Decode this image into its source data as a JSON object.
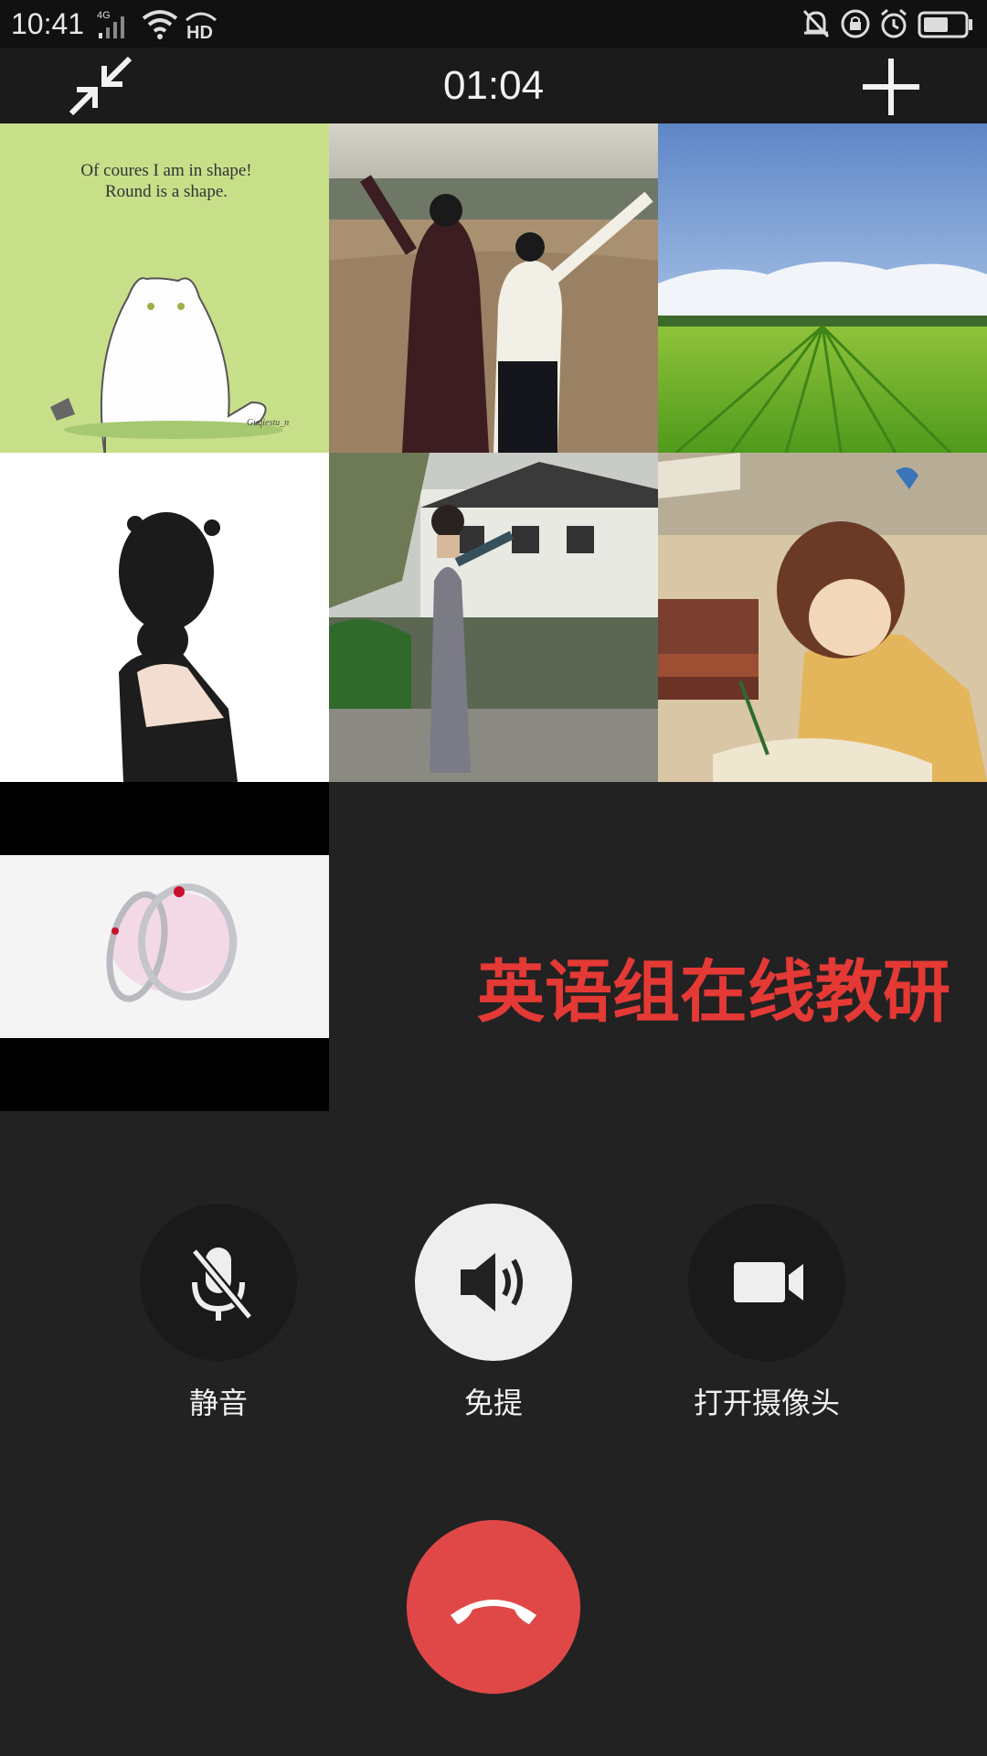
{
  "status_bar": {
    "time": "10:41",
    "network": "4G",
    "hd": "HD"
  },
  "header": {
    "timer": "01:04",
    "minimize_icon": "collapse-arrows-icon",
    "add_icon": "plus-icon"
  },
  "participants": [
    {
      "caption_line1": "Of coures I am in shape!",
      "caption_line2": "Round is a shape.",
      "signature": "Guqiestu_n"
    },
    {
      "caption_line1": "",
      "caption_line2": ""
    },
    {
      "caption_line1": "",
      "caption_line2": ""
    },
    {
      "caption_line1": "",
      "caption_line2": ""
    },
    {
      "caption_line1": "",
      "caption_line2": ""
    },
    {
      "caption_line1": "",
      "caption_line2": ""
    },
    {
      "caption_line1": "",
      "caption_line2": ""
    }
  ],
  "meeting_title": "英语组在线教研",
  "controls": {
    "mute_label": "静音",
    "speaker_label": "免提",
    "camera_label": "打开摄像头"
  },
  "colors": {
    "background": "#222222",
    "title_red": "#e53935",
    "hangup_red": "#e04848",
    "speaker_active": "#eeeeee"
  }
}
